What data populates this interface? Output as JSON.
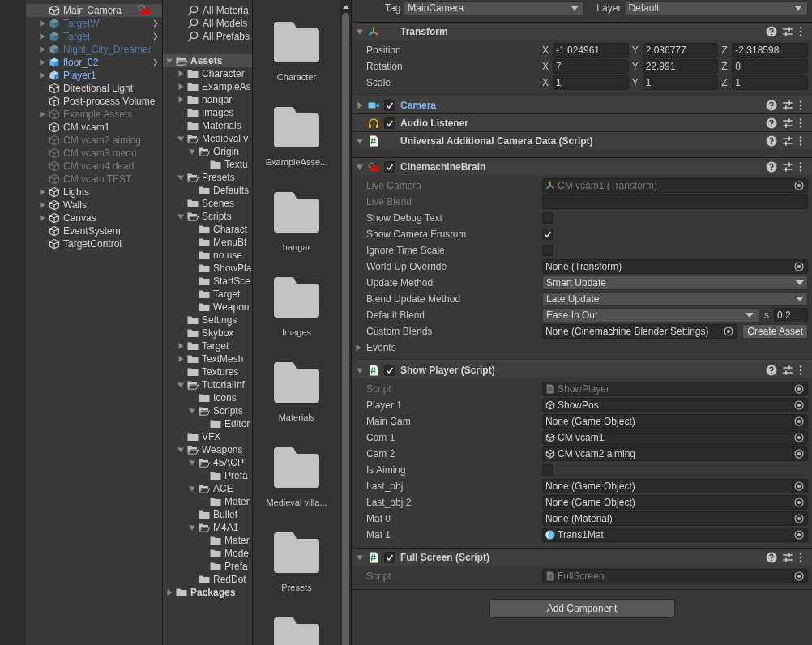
{
  "hierarchy": {
    "items": [
      {
        "label": "Main Camera",
        "kind": "brain_camera",
        "active": true,
        "selected": true
      },
      {
        "label": "TargetW",
        "kind": "prefab",
        "active": false,
        "selected": false,
        "expanded": false,
        "prefab_chevron": true
      },
      {
        "label": "Target",
        "kind": "prefab",
        "active": false,
        "selected": false,
        "expanded": false,
        "prefab_chevron": true
      },
      {
        "label": "Night_City_Dreamer",
        "kind": "model",
        "active": false,
        "selected": false,
        "expanded": false
      },
      {
        "label": "floor_02",
        "kind": "prefab",
        "active": true,
        "selected": false,
        "expanded": false,
        "prefab_chevron": true
      },
      {
        "label": "Player1",
        "kind": "model",
        "active": true,
        "selected": false,
        "expanded": false
      },
      {
        "label": "Directional Light",
        "kind": "gameobject",
        "active": true,
        "selected": false
      },
      {
        "label": "Post-process Volume",
        "kind": "gameobject",
        "active": true,
        "selected": false
      },
      {
        "label": "Example Assets",
        "kind": "gameobject",
        "active": false,
        "selected": false,
        "expanded": false
      },
      {
        "label": "CM vcam1",
        "kind": "gameobject",
        "active": true,
        "selected": false
      },
      {
        "label": "CM vcam2 aiming",
        "kind": "gameobject",
        "active": false,
        "selected": false
      },
      {
        "label": "CM vcam3 menu",
        "kind": "gameobject",
        "active": false,
        "selected": false
      },
      {
        "label": "CM vcam4 dead",
        "kind": "gameobject",
        "active": false,
        "selected": false
      },
      {
        "label": "CM vcam TEST",
        "kind": "gameobject",
        "active": false,
        "selected": false
      },
      {
        "label": "Lights",
        "kind": "gameobject",
        "active": true,
        "selected": false,
        "expanded": false
      },
      {
        "label": "Walls",
        "kind": "gameobject",
        "active": true,
        "selected": false,
        "expanded": false
      },
      {
        "label": "Canvas",
        "kind": "gameobject",
        "active": true,
        "selected": false,
        "expanded": false
      },
      {
        "label": "EventSystem",
        "kind": "gameobject",
        "active": true,
        "selected": false
      },
      {
        "label": "TargetControl",
        "kind": "gameobject",
        "active": true,
        "selected": false
      }
    ]
  },
  "project": {
    "favorites": [
      {
        "label": "All Materia"
      },
      {
        "label": "All Models"
      },
      {
        "label": "All Prefabs"
      }
    ],
    "tree": [
      {
        "label": "Assets",
        "expanded": true,
        "selected": true,
        "children": [
          {
            "label": "Character",
            "expanded": false,
            "selected": false
          },
          {
            "label": "ExampleAs",
            "expanded": false,
            "selected": false
          },
          {
            "label": "hangar",
            "expanded": false,
            "selected": false
          },
          {
            "label": "Images",
            "selected": false
          },
          {
            "label": "Materials",
            "selected": false
          },
          {
            "label": "Medieval v",
            "expanded": true,
            "selected": false,
            "children": [
              {
                "label": "Origin",
                "expanded": true,
                "selected": false,
                "children": [
                  {
                    "label": "Textu",
                    "selected": false
                  }
                ]
              }
            ]
          },
          {
            "label": "Presets",
            "expanded": true,
            "selected": false,
            "children": [
              {
                "label": "Defaults",
                "selected": false
              }
            ]
          },
          {
            "label": "Scenes",
            "selected": false
          },
          {
            "label": "Scripts",
            "expanded": true,
            "selected": false,
            "children": [
              {
                "label": "Charact",
                "selected": false
              },
              {
                "label": "MenuBt",
                "selected": false
              },
              {
                "label": "no use",
                "selected": false
              },
              {
                "label": "ShowPla",
                "selected": false
              },
              {
                "label": "StartSce",
                "selected": false
              },
              {
                "label": "Target",
                "selected": false
              },
              {
                "label": "Weapon",
                "selected": false
              }
            ]
          },
          {
            "label": "Settings",
            "selected": false
          },
          {
            "label": "Skybox",
            "selected": false
          },
          {
            "label": "Target",
            "expanded": false,
            "selected": false
          },
          {
            "label": "TextMesh",
            "expanded": false,
            "selected": false
          },
          {
            "label": "Textures",
            "selected": false
          },
          {
            "label": "TutorialInf",
            "expanded": true,
            "selected": false,
            "children": [
              {
                "label": "Icons",
                "selected": false
              },
              {
                "label": "Scripts",
                "expanded": true,
                "selected": false,
                "children": [
                  {
                    "label": "Editor",
                    "selected": false
                  }
                ]
              }
            ]
          },
          {
            "label": "VFX",
            "selected": false
          },
          {
            "label": "Weapons",
            "expanded": true,
            "selected": false,
            "children": [
              {
                "label": "45ACP",
                "expanded": true,
                "selected": false,
                "children": [
                  {
                    "label": "Prefa",
                    "selected": false
                  }
                ]
              },
              {
                "label": "ACE",
                "expanded": true,
                "selected": false,
                "children": [
                  {
                    "label": "Mater",
                    "selected": false
                  }
                ]
              },
              {
                "label": "Bullet",
                "selected": false
              },
              {
                "label": "M4A1",
                "expanded": true,
                "selected": false,
                "children": [
                  {
                    "label": "Mater",
                    "selected": false
                  },
                  {
                    "label": "Mode",
                    "selected": false
                  },
                  {
                    "label": "Prefa",
                    "selected": false
                  }
                ]
              },
              {
                "label": "RedDot",
                "selected": false
              }
            ]
          }
        ]
      },
      {
        "label": "Packages",
        "expanded": false,
        "selected": false
      }
    ],
    "grid": [
      {
        "kind": "folder",
        "label": "Character"
      },
      {
        "kind": "folder",
        "label": "ExampleAsse..."
      },
      {
        "kind": "folder",
        "label": "hangar"
      },
      {
        "kind": "folder",
        "label": "Images"
      },
      {
        "kind": "folder",
        "label": "Materials"
      },
      {
        "kind": "folder",
        "label": "Medieval villa..."
      },
      {
        "kind": "folder",
        "label": "Presets"
      },
      {
        "kind": "folder"
      }
    ]
  },
  "inspector": {
    "tag_label": "Tag",
    "tag": "MainCamera",
    "layer_label": "Layer",
    "layer": "Default",
    "components": [
      {
        "name": "Transform",
        "kind": "transform",
        "expanded": true,
        "highlighted": false,
        "fields": [
          {
            "kind": "vector3",
            "label": "Position",
            "values": [
              {
                "axis": "X",
                "value": "-1.024961"
              },
              {
                "axis": "Y",
                "value": "2.036777"
              },
              {
                "axis": "Z",
                "value": "-2.318598"
              }
            ]
          },
          {
            "kind": "vector3",
            "label": "Rotation",
            "values": [
              {
                "axis": "X",
                "value": "7"
              },
              {
                "axis": "Y",
                "value": "22.991"
              },
              {
                "axis": "Z",
                "value": "0"
              }
            ]
          },
          {
            "kind": "vector3",
            "label": "Scale",
            "values": [
              {
                "axis": "X",
                "value": "1"
              },
              {
                "axis": "Y",
                "value": "1"
              },
              {
                "axis": "Z",
                "value": "1"
              }
            ]
          }
        ]
      },
      {
        "name": "Camera",
        "kind": "camera",
        "expanded": false,
        "enabled": true,
        "highlighted": true
      },
      {
        "name": "Audio Listener",
        "kind": "audio",
        "enabled": true,
        "highlighted": false
      },
      {
        "name": "Universal Additional Camera Data (Script)",
        "kind": "script",
        "expanded": true,
        "highlighted": false
      },
      {
        "name": "CinemachineBrain",
        "kind": "cinemachine",
        "expanded": true,
        "enabled": true,
        "highlighted": false,
        "fields": [
          {
            "kind": "readonly_transform",
            "label": "Live Camera",
            "value": "CM vcam1 (Transform)"
          },
          {
            "kind": "readonly_text",
            "label": "Live Blend"
          },
          {
            "kind": "toggle",
            "label": "Show Debug Text",
            "checked": false
          },
          {
            "kind": "toggle",
            "label": "Show Camera Frustum",
            "checked": true
          },
          {
            "kind": "toggle",
            "label": "Ignore Time Scale",
            "checked": false
          },
          {
            "kind": "object",
            "label": "World Up Override",
            "value": "None (Transform)"
          },
          {
            "kind": "dropdown",
            "label": "Update Method",
            "value": "Smart Update"
          },
          {
            "kind": "dropdown",
            "label": "Blend Update Method",
            "value": "Late Update"
          },
          {
            "kind": "blend",
            "label": "Default Blend",
            "value": "Ease In Out",
            "unit": "s",
            "number": "0.2"
          },
          {
            "kind": "object_button",
            "label": "Custom Blends",
            "value": "None (Cinemachine Blender Settings)",
            "button": "Create Asset"
          },
          {
            "kind": "foldout",
            "label": "Events",
            "expanded": false
          }
        ]
      },
      {
        "name": "Show Player (Script)",
        "kind": "script",
        "expanded": true,
        "enabled": true,
        "highlighted": false,
        "fields": [
          {
            "kind": "readonly_script",
            "label": "Script",
            "value": "ShowPlayer"
          },
          {
            "kind": "object_gameobject",
            "label": "Player 1",
            "value": "ShowPos"
          },
          {
            "kind": "object",
            "label": "Main Cam",
            "value": "None (Game Object)"
          },
          {
            "kind": "object_gameobject",
            "label": "Cam 1",
            "value": "CM vcam1"
          },
          {
            "kind": "object_gameobject",
            "label": "Cam 2",
            "value": "CM vcam2 aiming"
          },
          {
            "kind": "toggle",
            "label": "Is Aiming",
            "checked": false
          },
          {
            "kind": "object",
            "label": "Last_obj",
            "value": "None (Game Object)"
          },
          {
            "kind": "object",
            "label": "Last_obj 2",
            "value": "None (Game Object)"
          },
          {
            "kind": "object",
            "label": "Mat 0",
            "value": "None (Material)"
          },
          {
            "kind": "object_material",
            "label": "Mat 1",
            "value": "Trans1Mat"
          }
        ]
      },
      {
        "name": "Full Screen (Script)",
        "kind": "script",
        "expanded": true,
        "enabled": true,
        "highlighted": false,
        "fields": [
          {
            "kind": "readonly_script",
            "label": "Script",
            "value": "FullScreen"
          }
        ]
      }
    ],
    "add_component": "Add Component"
  }
}
